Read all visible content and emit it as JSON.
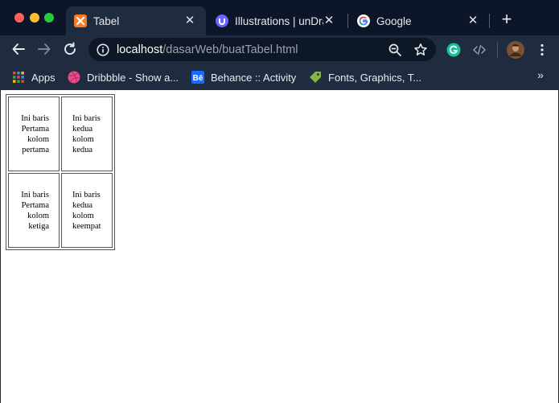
{
  "browser": {
    "tabs": [
      {
        "title": "Tabel",
        "active": true,
        "favicon": "xampp-icon"
      },
      {
        "title": "Illustrations | unDraw",
        "active": false,
        "favicon": "undraw-icon"
      },
      {
        "title": "Google",
        "active": false,
        "favicon": "google-icon"
      }
    ],
    "address_bar": {
      "host": "localhost",
      "path": "/dasarWeb/buatTabel.html"
    },
    "bookmarks": [
      {
        "label": "Apps",
        "icon": "apps-grid-icon"
      },
      {
        "label": "Dribbble - Show a...",
        "icon": "dribbble-icon"
      },
      {
        "label": "Behance :: Activity",
        "icon": "behance-icon"
      },
      {
        "label": "Fonts, Graphics, T...",
        "icon": "tag-icon"
      }
    ],
    "colors": {
      "tabstrip": "#0c1628",
      "toolbar": "#1f2b3e",
      "omnibox": "#0e1725"
    }
  },
  "page": {
    "table": {
      "rows": [
        [
          "Ini baris Pertama kolom pertama",
          "Ini baris kedua kolom kedua"
        ],
        [
          "Ini baris Pertama kolom ketiga",
          "Ini baris kedua kolom keempat"
        ]
      ]
    }
  }
}
